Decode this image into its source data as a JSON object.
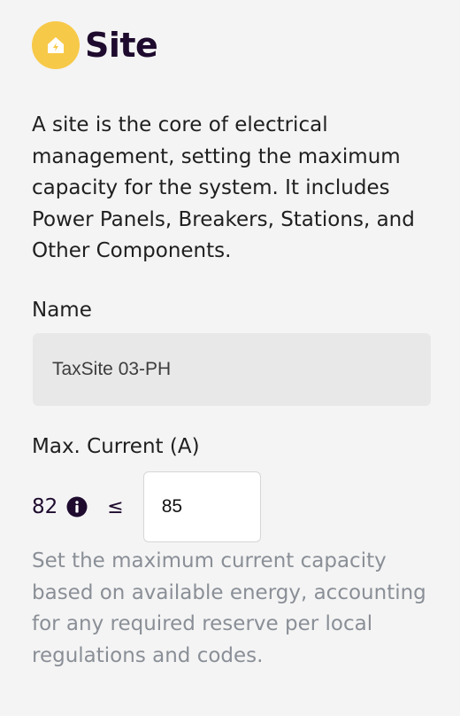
{
  "header": {
    "title": "Site",
    "icon": "site-lightning-home-icon",
    "badge_color": "#f7c948"
  },
  "description": "A site is the core of electrical management, setting the maximum capacity for the system. It includes Power Panels, Breakers, Stations, and Other Components.",
  "name_field": {
    "label": "Name",
    "value": "TaxSite 03-PH"
  },
  "max_current": {
    "label": "Max. Current (A)",
    "current_value": "82",
    "info_icon": "info-icon",
    "operator": "≤",
    "input_value": "85",
    "helper_text": "Set the maximum current capacity based on available energy, accounting for any required reserve per local regulations and codes."
  }
}
